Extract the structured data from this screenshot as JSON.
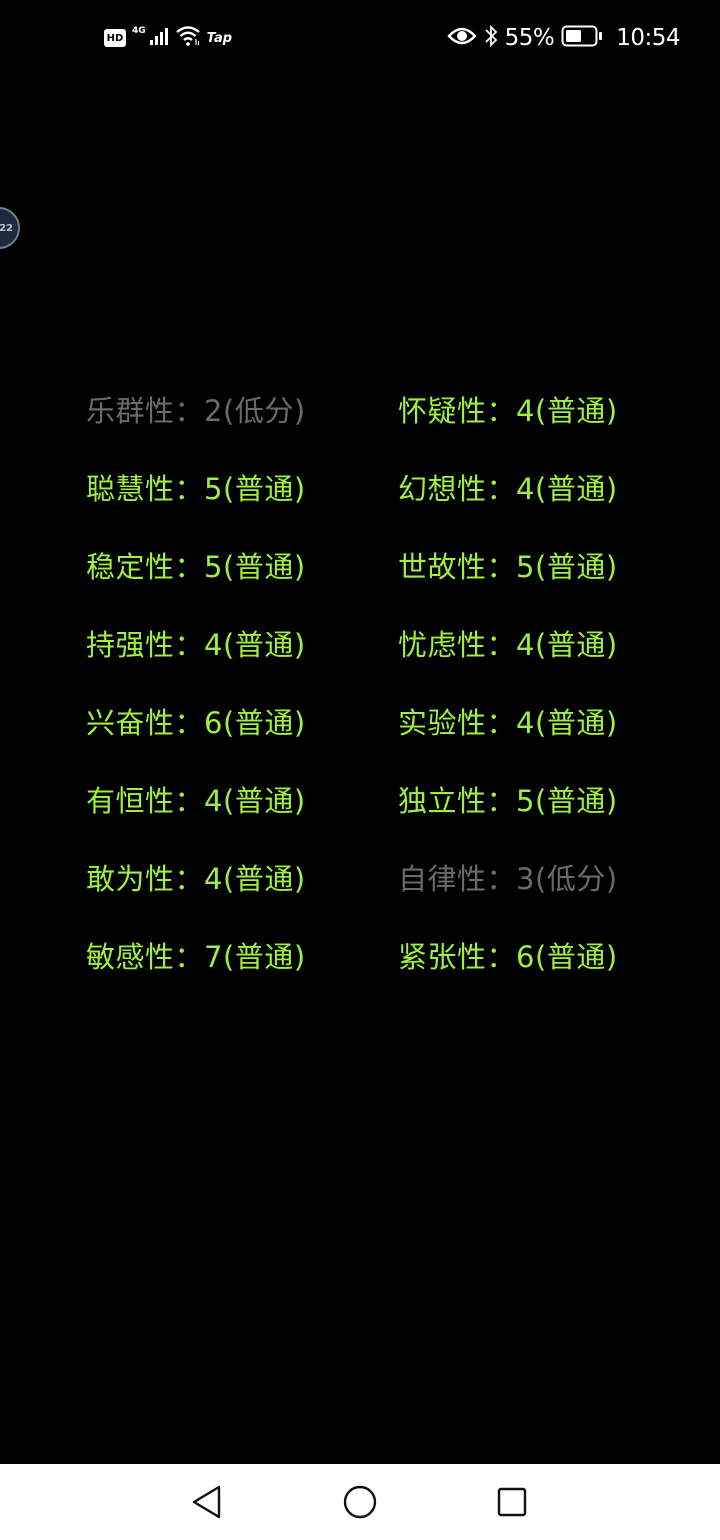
{
  "status_bar": {
    "hd": "HD",
    "network": "4G",
    "tap": "Tap",
    "battery_percent": "55%",
    "time": "10:54"
  },
  "floating_bubble": {
    "label": "22"
  },
  "traits": [
    {
      "name": "乐群性",
      "score": "2",
      "level": "低分",
      "column": "left",
      "row": 0
    },
    {
      "name": "怀疑性",
      "score": "4",
      "level": "普通",
      "column": "right",
      "row": 0
    },
    {
      "name": "聪慧性",
      "score": "5",
      "level": "普通",
      "column": "left",
      "row": 1
    },
    {
      "name": "幻想性",
      "score": "4",
      "level": "普通",
      "column": "right",
      "row": 1
    },
    {
      "name": "稳定性",
      "score": "5",
      "level": "普通",
      "column": "left",
      "row": 2
    },
    {
      "name": "世故性",
      "score": "5",
      "level": "普通",
      "column": "right",
      "row": 2
    },
    {
      "name": "持强性",
      "score": "4",
      "level": "普通",
      "column": "left",
      "row": 3
    },
    {
      "name": "忧虑性",
      "score": "4",
      "level": "普通",
      "column": "right",
      "row": 3
    },
    {
      "name": "兴奋性",
      "score": "6",
      "level": "普通",
      "column": "left",
      "row": 4
    },
    {
      "name": "实验性",
      "score": "4",
      "level": "普通",
      "column": "right",
      "row": 4
    },
    {
      "name": "有恒性",
      "score": "4",
      "level": "普通",
      "column": "left",
      "row": 5
    },
    {
      "name": "独立性",
      "score": "5",
      "level": "普通",
      "column": "right",
      "row": 5
    },
    {
      "name": "敢为性",
      "score": "4",
      "level": "普通",
      "column": "left",
      "row": 6
    },
    {
      "name": "自律性",
      "score": "3",
      "level": "低分",
      "column": "right",
      "row": 6
    },
    {
      "name": "敏感性",
      "score": "7",
      "level": "普通",
      "column": "left",
      "row": 7
    },
    {
      "name": "紧张性",
      "score": "6",
      "level": "普通",
      "column": "right",
      "row": 7
    }
  ],
  "colors": {
    "normal": "#9ef03c",
    "low": "#6a6a6a",
    "background": "#000000",
    "nav_bar": "#ffffff"
  },
  "nav_bar": {
    "back_icon": "back-triangle-icon",
    "home_icon": "home-circle-icon",
    "recents_icon": "recents-square-icon"
  }
}
